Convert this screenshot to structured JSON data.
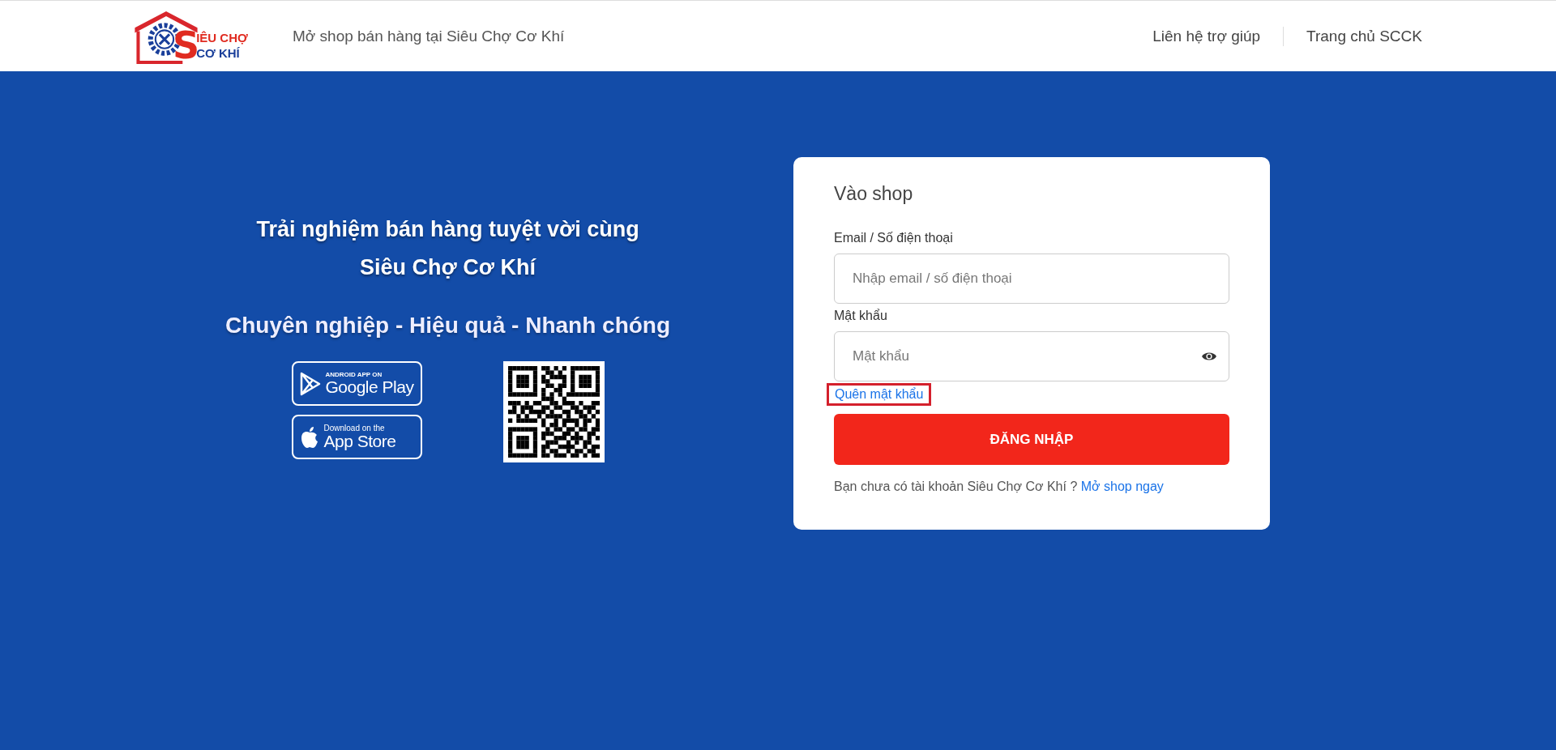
{
  "header": {
    "logo": {
      "letter": "S",
      "line_1": "IÊU CHỢ",
      "line_2": "CƠ KHÍ"
    },
    "tagline": "Mở shop bán hàng tại Siêu Chợ Cơ Khí",
    "links": [
      {
        "label": "Liên hệ trợ giúp"
      },
      {
        "label": "Trang chủ SCCK"
      }
    ]
  },
  "promo": {
    "headline_lines": [
      "Trải nghiệm bán hàng tuyệt vời cùng",
      "Siêu Chợ Cơ Khí"
    ],
    "slogan": "Chuyên nghiệp - Hiệu quả - Nhanh chóng",
    "badges": [
      {
        "kind": "google",
        "small": "ANDROID APP ON",
        "big": "Google Play"
      },
      {
        "kind": "apple",
        "small": "Download on the",
        "big": "App Store"
      }
    ]
  },
  "login": {
    "title": "Vào shop",
    "fields": [
      {
        "label": "Email / Số điện thoại",
        "placeholder": "Nhập email / số điện thoại",
        "kind": "text"
      },
      {
        "label": "Mật khẩu",
        "placeholder": "Mật khẩu",
        "kind": "password"
      }
    ],
    "forgot": {
      "label": "Quên mật khẩu",
      "highlighted": true
    },
    "submit": "ĐĂNG NHẬP",
    "signup_text": "Bạn chưa có tài khoản Siêu Chợ Cơ Khí ?",
    "signup_link": "Mở shop ngay"
  }
}
